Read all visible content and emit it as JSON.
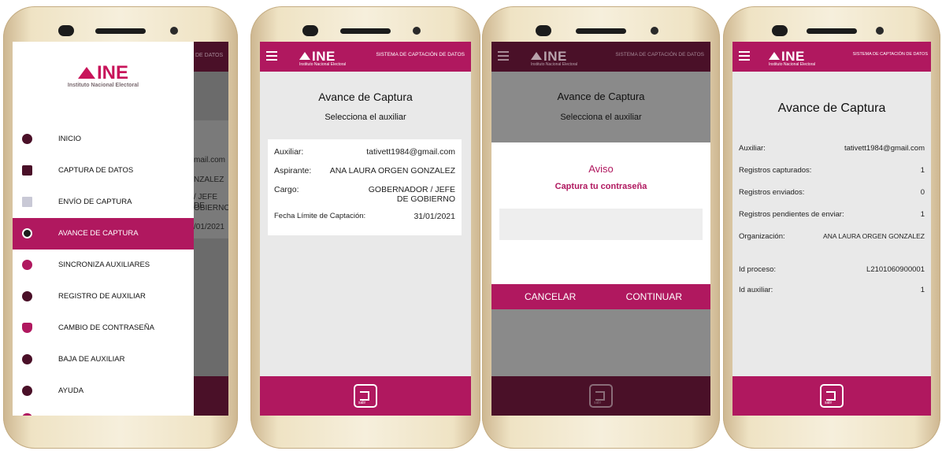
{
  "common": {
    "logo": "INE",
    "logo_sub_header": "Instituto Nacional Electoral",
    "logo_sub_drawer": "Instituto Nacional Electoral",
    "system_title": "SISTEMA DE CAPTACIÓN DE DATOS",
    "capture_title": "Avance de Captura",
    "select_aux": "Selecciona el auxiliar"
  },
  "screen1": {
    "menu": [
      {
        "label": "INICIO",
        "icon": "home-icon"
      },
      {
        "label": "CAPTURA DE DATOS",
        "icon": "capture-icon"
      },
      {
        "label": "ENVÍO DE CAPTURA",
        "icon": "mail-icon"
      },
      {
        "label": "AVANCE DE CAPTURA",
        "icon": "progress-icon",
        "active": true
      },
      {
        "label": "SINCRONIZA AUXILIARES",
        "icon": "sync-icon"
      },
      {
        "label": "REGISTRO DE AUXILIAR",
        "icon": "add-user-icon"
      },
      {
        "label": "CAMBIO DE CONTRASEÑA",
        "icon": "shield-icon"
      },
      {
        "label": "BAJA DE AUXILIAR",
        "icon": "remove-user-icon"
      },
      {
        "label": "AYUDA",
        "icon": "help-icon"
      }
    ],
    "behind_text": [
      "DE DATOS",
      "mail.com",
      "NZALEZ",
      "/ JEFE DE",
      "OBIERNO",
      "/01/2021"
    ]
  },
  "screen2": {
    "rows": [
      {
        "k": "Auxiliar:",
        "v": "tativett1984@gmail.com"
      },
      {
        "k": "Aspirante:",
        "v": "ANA LAURA ORGEN GONZALEZ"
      },
      {
        "k": "Cargo:",
        "v": "GOBERNADOR / JEFE DE GOBIERNO"
      },
      {
        "k": "Fecha Límite de Captación:",
        "v": "31/01/2021"
      }
    ]
  },
  "screen3": {
    "modal_title": "Aviso",
    "modal_subtitle": "Captura tu contraseña",
    "cancel": "CANCELAR",
    "continue": "CONTINUAR"
  },
  "screen4": {
    "rows": [
      {
        "k": "Auxiliar:",
        "v": "tativett1984@gmail.com"
      },
      {
        "k": "Registros capturados:",
        "v": "1"
      },
      {
        "k": "Registros enviados:",
        "v": "0"
      },
      {
        "k": "Registros pendientes de enviar:",
        "v": "1"
      },
      {
        "k": "Organización:",
        "v": "ANA LAURA ORGEN GONZALEZ"
      },
      {
        "k": "Id proceso:",
        "v": "L2101060900001"
      },
      {
        "k": "Id auxiliar:",
        "v": "1"
      }
    ]
  },
  "colors": {
    "brand": "#b0185f",
    "dark": "#4a1028"
  }
}
